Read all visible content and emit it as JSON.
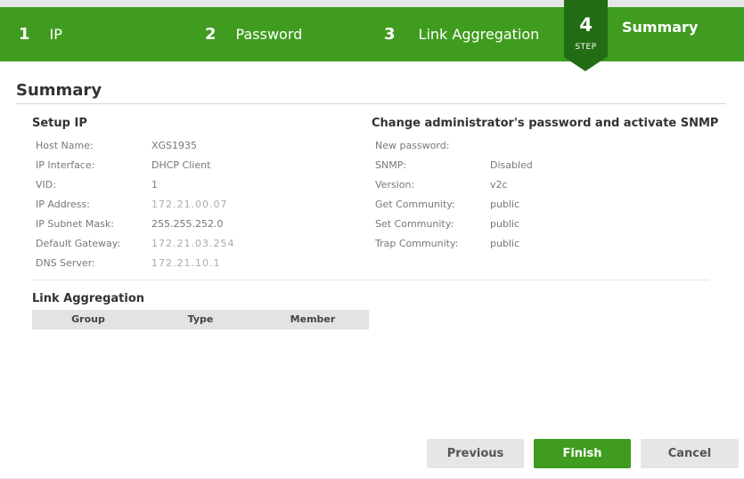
{
  "wizard": {
    "steps": [
      {
        "num": "1",
        "label": "IP"
      },
      {
        "num": "2",
        "label": "Password"
      },
      {
        "num": "3",
        "label": "Link Aggregation"
      }
    ],
    "active": {
      "num": "4",
      "sub": "STEP",
      "label": "Summary"
    }
  },
  "page": {
    "title": "Summary"
  },
  "setup_ip": {
    "heading": "Setup IP",
    "rows": [
      {
        "key": "Host Name:",
        "value": "XGS1935"
      },
      {
        "key": "IP Interface:",
        "value": "DHCP Client"
      },
      {
        "key": "VID:",
        "value": "1"
      },
      {
        "key": "IP Address:",
        "value": "172.21.00.07"
      },
      {
        "key": "IP Subnet Mask:",
        "value": "255.255.252.0"
      },
      {
        "key": "Default Gateway:",
        "value": "172.21.03.254"
      },
      {
        "key": "DNS Server:",
        "value": "172.21.10.1"
      }
    ]
  },
  "password": {
    "heading": "Change administrator's password and activate SNMP",
    "rows": [
      {
        "key": "New password:",
        "value": ""
      },
      {
        "key": "SNMP:",
        "value": "Disabled"
      },
      {
        "key": "Version:",
        "value": "v2c"
      },
      {
        "key": "Get Community:",
        "value": "public"
      },
      {
        "key": "Set Community:",
        "value": "public"
      },
      {
        "key": "Trap Community:",
        "value": "public"
      }
    ]
  },
  "link_aggregation": {
    "heading": "Link Aggregation",
    "columns": [
      "Group",
      "Type",
      "Member"
    ]
  },
  "buttons": {
    "previous": "Previous",
    "finish": "Finish",
    "cancel": "Cancel"
  }
}
